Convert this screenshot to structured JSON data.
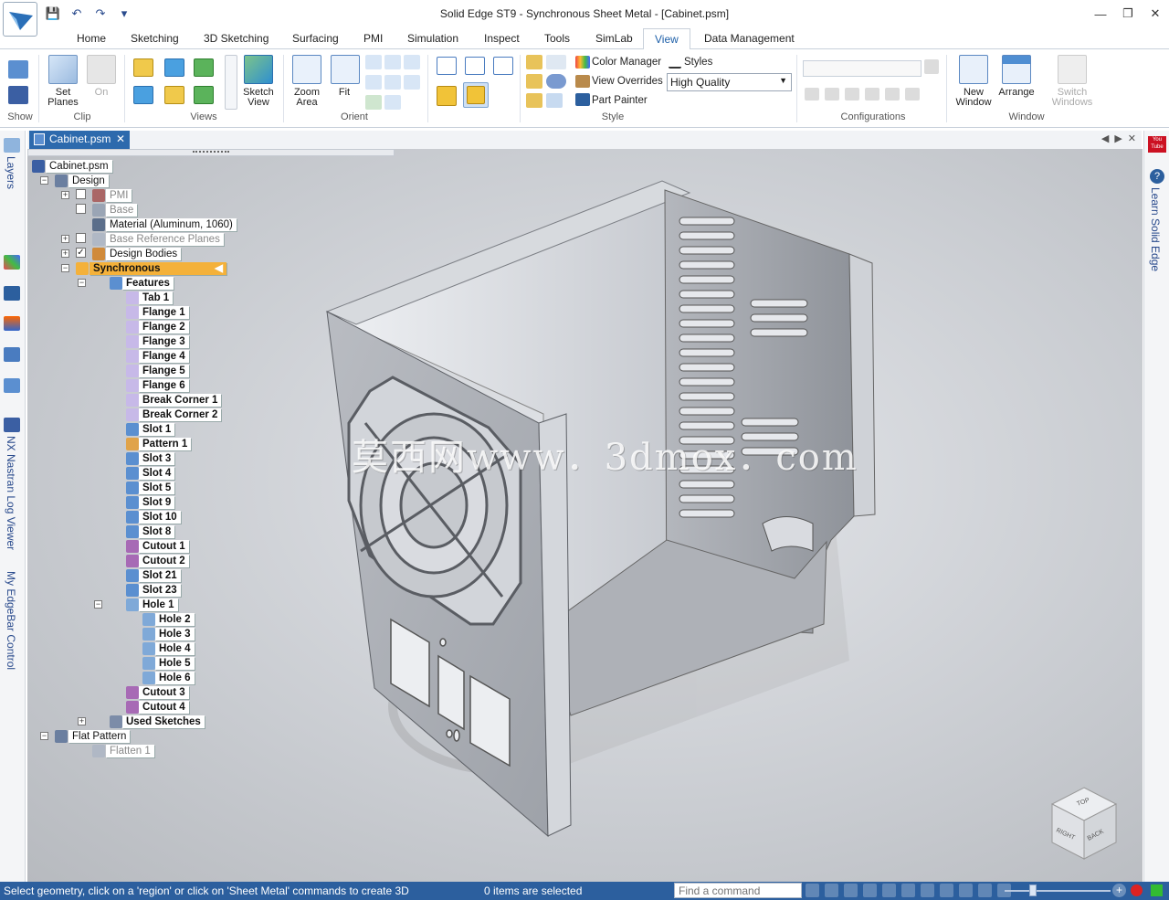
{
  "window": {
    "title": "Solid Edge ST9 - Synchronous Sheet Metal - [Cabinet.psm]",
    "controls": [
      "minimize",
      "restore",
      "close"
    ]
  },
  "ribbon_tabs": [
    "Home",
    "Sketching",
    "3D Sketching",
    "Surfacing",
    "PMI",
    "Simulation",
    "Inspect",
    "Tools",
    "SimLab",
    "View",
    "Data Management"
  ],
  "active_tab": "View",
  "ribbon": {
    "show": {
      "label": "Show"
    },
    "clip": {
      "label": "Clip",
      "set_planes": "Set Planes",
      "on": "On"
    },
    "views": {
      "label": "Views",
      "sketch_view": "Sketch View"
    },
    "orient": {
      "label": "Orient",
      "zoom_area": "Zoom Area",
      "fit": "Fit"
    },
    "style": {
      "label": "Style",
      "color_manager": "Color Manager",
      "styles": "Styles",
      "view_overrides": "View Overrides",
      "quality": "High Quality",
      "part_painter": "Part Painter"
    },
    "configurations": {
      "label": "Configurations",
      "value": ""
    },
    "window": {
      "label": "Window",
      "new_window": "New Window",
      "arrange": "Arrange",
      "switch_windows": "Switch Windows"
    }
  },
  "document_tab": {
    "label": "Cabinet.psm"
  },
  "left_rail": {
    "layers": "Layers",
    "nastran": "NX Nastran Log Viewer",
    "edgebar": "My EdgeBar Control"
  },
  "right_rail": {
    "learn": "Learn Solid Edge",
    "youtube": "You Tube"
  },
  "tree": {
    "root": "Cabinet.psm",
    "design": "Design",
    "pmi": "PMI",
    "base": "Base",
    "material": "Material (Aluminum, 1060)",
    "base_ref_planes": "Base Reference Planes",
    "design_bodies": "Design Bodies",
    "synchronous": "Synchronous",
    "features": "Features",
    "items": [
      "Tab 1",
      "Flange 1",
      "Flange 2",
      "Flange 3",
      "Flange 4",
      "Flange 5",
      "Flange 6",
      "Break Corner 1",
      "Break Corner 2",
      "Slot 1",
      "Pattern 1",
      "Slot 3",
      "Slot 4",
      "Slot 5",
      "Slot 9",
      "Slot 10",
      "Slot 8",
      "Cutout 1",
      "Cutout 2",
      "Slot 21",
      "Slot 23",
      "Hole 1"
    ],
    "hole_children": [
      "Hole 2",
      "Hole 3",
      "Hole 4",
      "Hole 5",
      "Hole 6"
    ],
    "after_holes": [
      "Cutout 3",
      "Cutout 4"
    ],
    "used_sketches": "Used Sketches",
    "flat_pattern": "Flat Pattern",
    "flatten": "Flatten 1"
  },
  "watermark": "莫西网www．3dmox．com",
  "view_cube": {
    "top": "TOP",
    "right": "RIGHT",
    "back": "BACK"
  },
  "status": {
    "prompt": "Select geometry, click on a 'region' or click on 'Sheet Metal' commands to create 3D",
    "selection": "0 items are selected",
    "find_placeholder": "Find a command",
    "zoom_level": 0.25
  },
  "colors": {
    "accent": "#2c5f9e",
    "tab_active": "#2d6aad",
    "selected_node": "#f4b13a"
  }
}
